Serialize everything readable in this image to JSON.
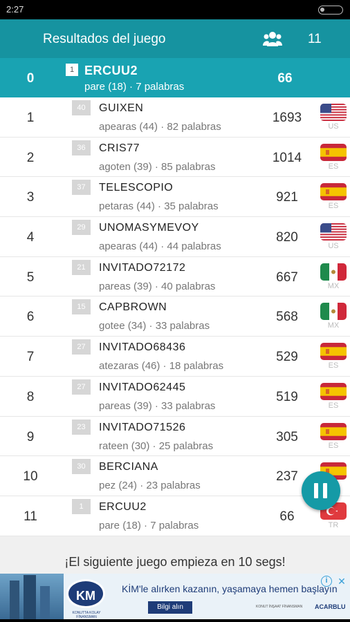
{
  "status_bar": {
    "time": "2:27"
  },
  "app_bar": {
    "title": "Resultados del juego",
    "players_icon": "group-icon",
    "players_count": "11"
  },
  "me": {
    "rank": "0",
    "level": "1",
    "name": "ERCUU2",
    "detail": "pare (18) · 7 palabras",
    "score": "66"
  },
  "players": [
    {
      "rank": "1",
      "level": "40",
      "name": "GUIXEN",
      "detail": "apearas (44) · 82 palabras",
      "score": "1693",
      "country": "US",
      "flag": "us"
    },
    {
      "rank": "2",
      "level": "36",
      "name": "CRIS77",
      "detail": "agoten (39) · 85 palabras",
      "score": "1014",
      "country": "ES",
      "flag": "es"
    },
    {
      "rank": "3",
      "level": "37",
      "name": "TELESCOPIO",
      "detail": "petaras (44) · 35 palabras",
      "score": "921",
      "country": "ES",
      "flag": "es"
    },
    {
      "rank": "4",
      "level": "29",
      "name": "UNOMASYMEVOY",
      "detail": "apearas (44) · 44 palabras",
      "score": "820",
      "country": "US",
      "flag": "us"
    },
    {
      "rank": "5",
      "level": "21",
      "name": "INVITADO72172",
      "detail": "pareas (39) · 40 palabras",
      "score": "667",
      "country": "MX",
      "flag": "mx"
    },
    {
      "rank": "6",
      "level": "15",
      "name": "CAPBROWN",
      "detail": "gotee (34) · 33 palabras",
      "score": "568",
      "country": "MX",
      "flag": "mx"
    },
    {
      "rank": "7",
      "level": "27",
      "name": "INVITADO68436",
      "detail": "atezaras (46) · 18 palabras",
      "score": "529",
      "country": "ES",
      "flag": "es"
    },
    {
      "rank": "8",
      "level": "27",
      "name": "INVITADO62445",
      "detail": "pareas (39) · 33 palabras",
      "score": "519",
      "country": "ES",
      "flag": "es"
    },
    {
      "rank": "9",
      "level": "23",
      "name": "INVITADO71526",
      "detail": "rateen (30) · 25 palabras",
      "score": "305",
      "country": "ES",
      "flag": "es"
    },
    {
      "rank": "10",
      "level": "30",
      "name": "BERCIANA",
      "detail": "pez (24) · 23 palabras",
      "score": "237",
      "country": "ES",
      "flag": "es"
    },
    {
      "rank": "11",
      "level": "1",
      "name": "ERCUU2",
      "detail": "pare (18) · 7 palabras",
      "score": "66",
      "country": "TR",
      "flag": "tr"
    }
  ],
  "footer": {
    "message": "¡El siguiente juego empieza en 10 segs!"
  },
  "ad": {
    "logo": "KM",
    "logo_sub": "KONUTTA KOLAY FİNANSMAN",
    "headline": "KİM'le alırken kazanın, yaşamaya hemen başlayın",
    "cta": "Bilgi alın",
    "brand1": "KONUT İNŞAAT FİNANSMAN",
    "brand2": "ACARBLU"
  },
  "colors": {
    "app_bar": "#1693a0",
    "me_row": "#19a3b2",
    "pause_button": "#159aa6"
  }
}
